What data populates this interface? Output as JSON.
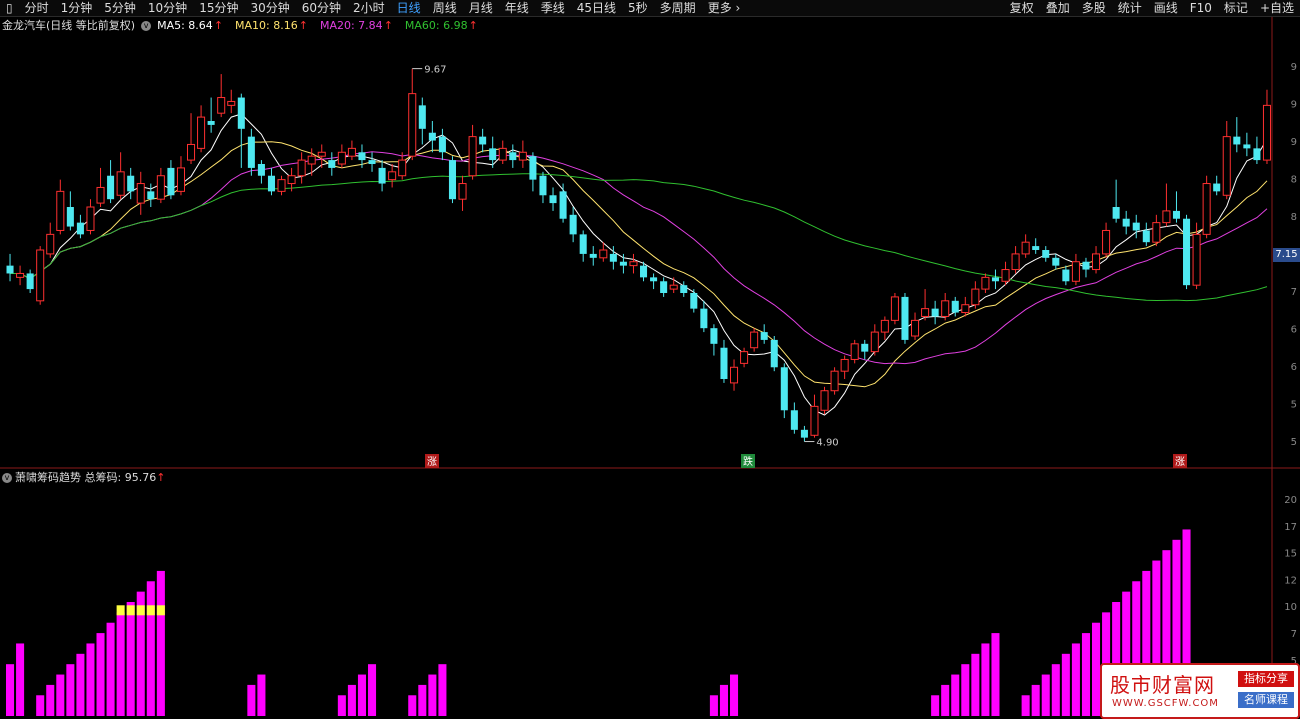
{
  "toolbar": {
    "periods": [
      "分时",
      "1分钟",
      "5分钟",
      "10分钟",
      "15分钟",
      "30分钟",
      "60分钟",
      "2小时",
      "日线",
      "周线",
      "月线",
      "年线",
      "季线",
      "45日线",
      "5秒",
      "多周期",
      "更多"
    ],
    "active_period": "日线",
    "right_tools": [
      "复权",
      "叠加",
      "多股",
      "统计",
      "画线",
      "F10",
      "标记",
      "+自选"
    ]
  },
  "main_legend": {
    "title": "金龙汽车(日线 等比前复权)",
    "ma5": "MA5: 8.64",
    "ma10": "MA10: 8.16",
    "ma20": "MA20: 7.84",
    "ma60": "MA60: 6.98",
    "arrow": "↑"
  },
  "colors": {
    "up": "#ff3030",
    "down": "#4ee8f0",
    "ma5": "#ffffff",
    "ma10": "#ffe36e",
    "ma20": "#e040e0",
    "ma60": "#30c030",
    "bar": "#ff00ff",
    "bar_top": "#ffff40"
  },
  "price_axis": [
    "9",
    "9",
    "9",
    "8",
    "8",
    "7",
    "7",
    "6",
    "6",
    "5",
    "5"
  ],
  "volume_axis": [
    "20",
    "17",
    "15",
    "12",
    "10",
    "7",
    "5"
  ],
  "current_price": "7.15",
  "annotations": {
    "high": "9.67",
    "low": "4.90"
  },
  "marks": [
    "涨",
    "跌",
    "涨"
  ],
  "indicator_legend": {
    "title": "萧啸筹码趋势 总筹码: 95.76",
    "arrow": "↑"
  },
  "watermark": {
    "title": "股市财富网",
    "url": "WWW.GSCFW.COM",
    "tag1": "指标分享",
    "tag2": "名师课程"
  },
  "chart_data": {
    "type": "candlestick",
    "ma_periods": [
      5,
      10,
      20,
      60
    ],
    "candles": [
      [
        7.15,
        7.05,
        7.3,
        6.95
      ],
      [
        7.0,
        7.05,
        7.15,
        6.9
      ],
      [
        7.05,
        6.85,
        7.1,
        6.8
      ],
      [
        6.7,
        7.35,
        7.4,
        6.65
      ],
      [
        7.3,
        7.55,
        7.7,
        7.25
      ],
      [
        7.6,
        8.1,
        8.25,
        7.55
      ],
      [
        7.9,
        7.65,
        8.1,
        7.6
      ],
      [
        7.7,
        7.55,
        7.8,
        7.5
      ],
      [
        7.6,
        7.9,
        8.0,
        7.55
      ],
      [
        7.95,
        8.15,
        8.4,
        7.9
      ],
      [
        8.3,
        8.0,
        8.5,
        7.95
      ],
      [
        8.05,
        8.35,
        8.6,
        8.0
      ],
      [
        8.3,
        8.1,
        8.4,
        8.0
      ],
      [
        7.95,
        8.2,
        8.35,
        7.8
      ],
      [
        8.1,
        8.0,
        8.2,
        7.9
      ],
      [
        8.0,
        8.3,
        8.4,
        7.95
      ],
      [
        8.4,
        8.05,
        8.5,
        8.0
      ],
      [
        8.1,
        8.4,
        8.55,
        8.05
      ],
      [
        8.5,
        8.7,
        9.1,
        8.45
      ],
      [
        8.65,
        9.05,
        9.2,
        8.6
      ],
      [
        9.0,
        8.95,
        9.3,
        8.85
      ],
      [
        9.1,
        9.3,
        9.6,
        9.05
      ],
      [
        9.2,
        9.25,
        9.4,
        9.1
      ],
      [
        9.3,
        8.9,
        9.35,
        8.4
      ],
      [
        8.8,
        8.4,
        8.9,
        8.3
      ],
      [
        8.45,
        8.3,
        8.5,
        8.2
      ],
      [
        8.3,
        8.1,
        8.4,
        8.05
      ],
      [
        8.1,
        8.25,
        8.3,
        8.05
      ],
      [
        8.2,
        8.3,
        8.4,
        8.1
      ],
      [
        8.3,
        8.5,
        8.6,
        8.2
      ],
      [
        8.45,
        8.55,
        8.65,
        8.3
      ],
      [
        8.55,
        8.6,
        8.7,
        8.4
      ],
      [
        8.5,
        8.4,
        8.6,
        8.3
      ],
      [
        8.45,
        8.6,
        8.7,
        8.4
      ],
      [
        8.55,
        8.65,
        8.75,
        8.5
      ],
      [
        8.6,
        8.5,
        8.7,
        8.4
      ],
      [
        8.5,
        8.45,
        8.6,
        8.35
      ],
      [
        8.4,
        8.2,
        8.5,
        8.1
      ],
      [
        8.25,
        8.35,
        8.45,
        8.15
      ],
      [
        8.3,
        8.5,
        8.6,
        8.25
      ],
      [
        8.55,
        9.35,
        9.67,
        8.5
      ],
      [
        9.2,
        8.9,
        9.3,
        8.7
      ],
      [
        8.85,
        8.75,
        9.0,
        8.6
      ],
      [
        8.8,
        8.6,
        8.9,
        8.5
      ],
      [
        8.5,
        8.0,
        8.55,
        7.95
      ],
      [
        8.0,
        8.2,
        8.3,
        7.85
      ],
      [
        8.3,
        8.8,
        8.95,
        8.25
      ],
      [
        8.8,
        8.7,
        8.9,
        8.6
      ],
      [
        8.65,
        8.5,
        8.8,
        8.4
      ],
      [
        8.5,
        8.65,
        8.75,
        8.45
      ],
      [
        8.6,
        8.5,
        8.7,
        8.4
      ],
      [
        8.5,
        8.6,
        8.75,
        8.4
      ],
      [
        8.55,
        8.25,
        8.6,
        8.1
      ],
      [
        8.3,
        8.05,
        8.35,
        7.95
      ],
      [
        8.05,
        7.95,
        8.15,
        7.85
      ],
      [
        8.1,
        7.75,
        8.2,
        7.7
      ],
      [
        7.8,
        7.55,
        7.9,
        7.45
      ],
      [
        7.55,
        7.3,
        7.6,
        7.2
      ],
      [
        7.3,
        7.25,
        7.4,
        7.15
      ],
      [
        7.25,
        7.35,
        7.45,
        7.2
      ],
      [
        7.3,
        7.2,
        7.4,
        7.1
      ],
      [
        7.2,
        7.15,
        7.3,
        7.05
      ],
      [
        7.15,
        7.2,
        7.3,
        7.05
      ],
      [
        7.15,
        7.0,
        7.2,
        6.95
      ],
      [
        7.0,
        6.95,
        7.05,
        6.85
      ],
      [
        6.95,
        6.8,
        7.0,
        6.75
      ],
      [
        6.85,
        6.9,
        7.0,
        6.8
      ],
      [
        6.9,
        6.8,
        6.95,
        6.75
      ],
      [
        6.8,
        6.6,
        6.85,
        6.55
      ],
      [
        6.6,
        6.35,
        6.7,
        6.3
      ],
      [
        6.35,
        6.15,
        6.4,
        6.0
      ],
      [
        6.1,
        5.7,
        6.2,
        5.65
      ],
      [
        5.65,
        5.85,
        5.95,
        5.55
      ],
      [
        5.9,
        6.05,
        6.1,
        5.85
      ],
      [
        6.1,
        6.3,
        6.35,
        6.05
      ],
      [
        6.3,
        6.2,
        6.4,
        6.15
      ],
      [
        6.2,
        5.85,
        6.25,
        5.8
      ],
      [
        5.85,
        5.3,
        5.9,
        5.2
      ],
      [
        5.3,
        5.05,
        5.4,
        5.0
      ],
      [
        5.05,
        4.95,
        5.1,
        4.9
      ],
      [
        4.98,
        5.35,
        5.5,
        4.95
      ],
      [
        5.3,
        5.55,
        5.6,
        5.25
      ],
      [
        5.55,
        5.8,
        5.85,
        5.5
      ],
      [
        5.8,
        5.95,
        6.0,
        5.7
      ],
      [
        5.95,
        6.15,
        6.2,
        5.9
      ],
      [
        6.15,
        6.05,
        6.2,
        5.95
      ],
      [
        6.05,
        6.3,
        6.4,
        6.0
      ],
      [
        6.3,
        6.45,
        6.5,
        6.2
      ],
      [
        6.45,
        6.75,
        6.8,
        6.4
      ],
      [
        6.75,
        6.2,
        6.8,
        6.15
      ],
      [
        6.25,
        6.45,
        6.55,
        6.2
      ],
      [
        6.5,
        6.6,
        6.85,
        6.45
      ],
      [
        6.6,
        6.5,
        6.7,
        6.4
      ],
      [
        6.5,
        6.7,
        6.8,
        6.45
      ],
      [
        6.7,
        6.55,
        6.75,
        6.5
      ],
      [
        6.55,
        6.65,
        6.75,
        6.5
      ],
      [
        6.65,
        6.85,
        6.95,
        6.6
      ],
      [
        6.85,
        7.0,
        7.05,
        6.8
      ],
      [
        7.0,
        6.95,
        7.1,
        6.85
      ],
      [
        6.95,
        7.1,
        7.2,
        6.9
      ],
      [
        7.1,
        7.3,
        7.4,
        7.05
      ],
      [
        7.3,
        7.45,
        7.55,
        7.25
      ],
      [
        7.4,
        7.35,
        7.5,
        7.3
      ],
      [
        7.35,
        7.25,
        7.4,
        7.2
      ],
      [
        7.25,
        7.15,
        7.3,
        7.1
      ],
      [
        7.1,
        6.95,
        7.15,
        6.9
      ],
      [
        6.95,
        7.2,
        7.3,
        6.9
      ],
      [
        7.2,
        7.1,
        7.25,
        7.0
      ],
      [
        7.1,
        7.3,
        7.4,
        7.05
      ],
      [
        7.3,
        7.6,
        7.7,
        7.25
      ],
      [
        7.9,
        7.75,
        8.25,
        7.7
      ],
      [
        7.75,
        7.65,
        7.85,
        7.55
      ],
      [
        7.7,
        7.6,
        7.8,
        7.5
      ],
      [
        7.6,
        7.45,
        7.7,
        7.4
      ],
      [
        7.45,
        7.7,
        7.8,
        7.4
      ],
      [
        7.7,
        7.85,
        8.2,
        7.65
      ],
      [
        7.85,
        7.75,
        8.1,
        7.7
      ],
      [
        7.75,
        6.9,
        7.8,
        6.85
      ],
      [
        6.9,
        7.55,
        7.7,
        6.85
      ],
      [
        7.55,
        8.2,
        8.3,
        7.5
      ],
      [
        8.2,
        8.1,
        8.3,
        8.05
      ],
      [
        8.05,
        8.8,
        9.0,
        8.0
      ],
      [
        8.8,
        8.7,
        9.05,
        8.6
      ],
      [
        8.7,
        8.65,
        8.85,
        8.55
      ],
      [
        8.65,
        8.5,
        8.8,
        8.45
      ],
      [
        8.5,
        9.2,
        9.4,
        8.45
      ]
    ],
    "indicator": [
      5,
      7,
      0,
      2,
      3,
      4,
      5,
      6,
      7,
      8,
      9,
      10,
      11,
      12,
      13,
      14,
      0,
      0,
      0,
      0,
      0,
      0,
      0,
      0,
      3,
      4,
      0,
      0,
      0,
      0,
      0,
      0,
      0,
      2,
      3,
      4,
      5,
      0,
      0,
      0,
      2,
      3,
      4,
      5,
      0,
      0,
      0,
      0,
      0,
      0,
      0,
      0,
      0,
      0,
      0,
      0,
      0,
      0,
      0,
      0,
      0,
      0,
      0,
      0,
      0,
      0,
      0,
      0,
      0,
      0,
      2,
      3,
      4,
      0,
      0,
      0,
      0,
      0,
      0,
      0,
      0,
      0,
      0,
      0,
      0,
      0,
      0,
      0,
      0,
      0,
      0,
      0,
      2,
      3,
      4,
      5,
      6,
      7,
      8,
      0,
      0,
      2,
      3,
      4,
      5,
      6,
      7,
      8,
      9,
      10,
      11,
      12,
      13,
      14,
      15,
      16,
      17,
      18,
      0,
      0,
      0,
      0,
      0,
      0,
      0,
      0,
      0,
      0,
      0,
      0,
      0,
      0,
      0,
      1,
      2,
      3,
      0,
      0,
      0,
      0,
      6,
      7
    ],
    "indicator_top_segment": [
      11,
      12,
      13,
      14,
      15,
      120,
      121,
      122,
      123,
      124,
      125,
      126,
      127
    ],
    "price_range": [
      4.6,
      10.1
    ],
    "indicator_range": [
      0,
      22
    ]
  }
}
